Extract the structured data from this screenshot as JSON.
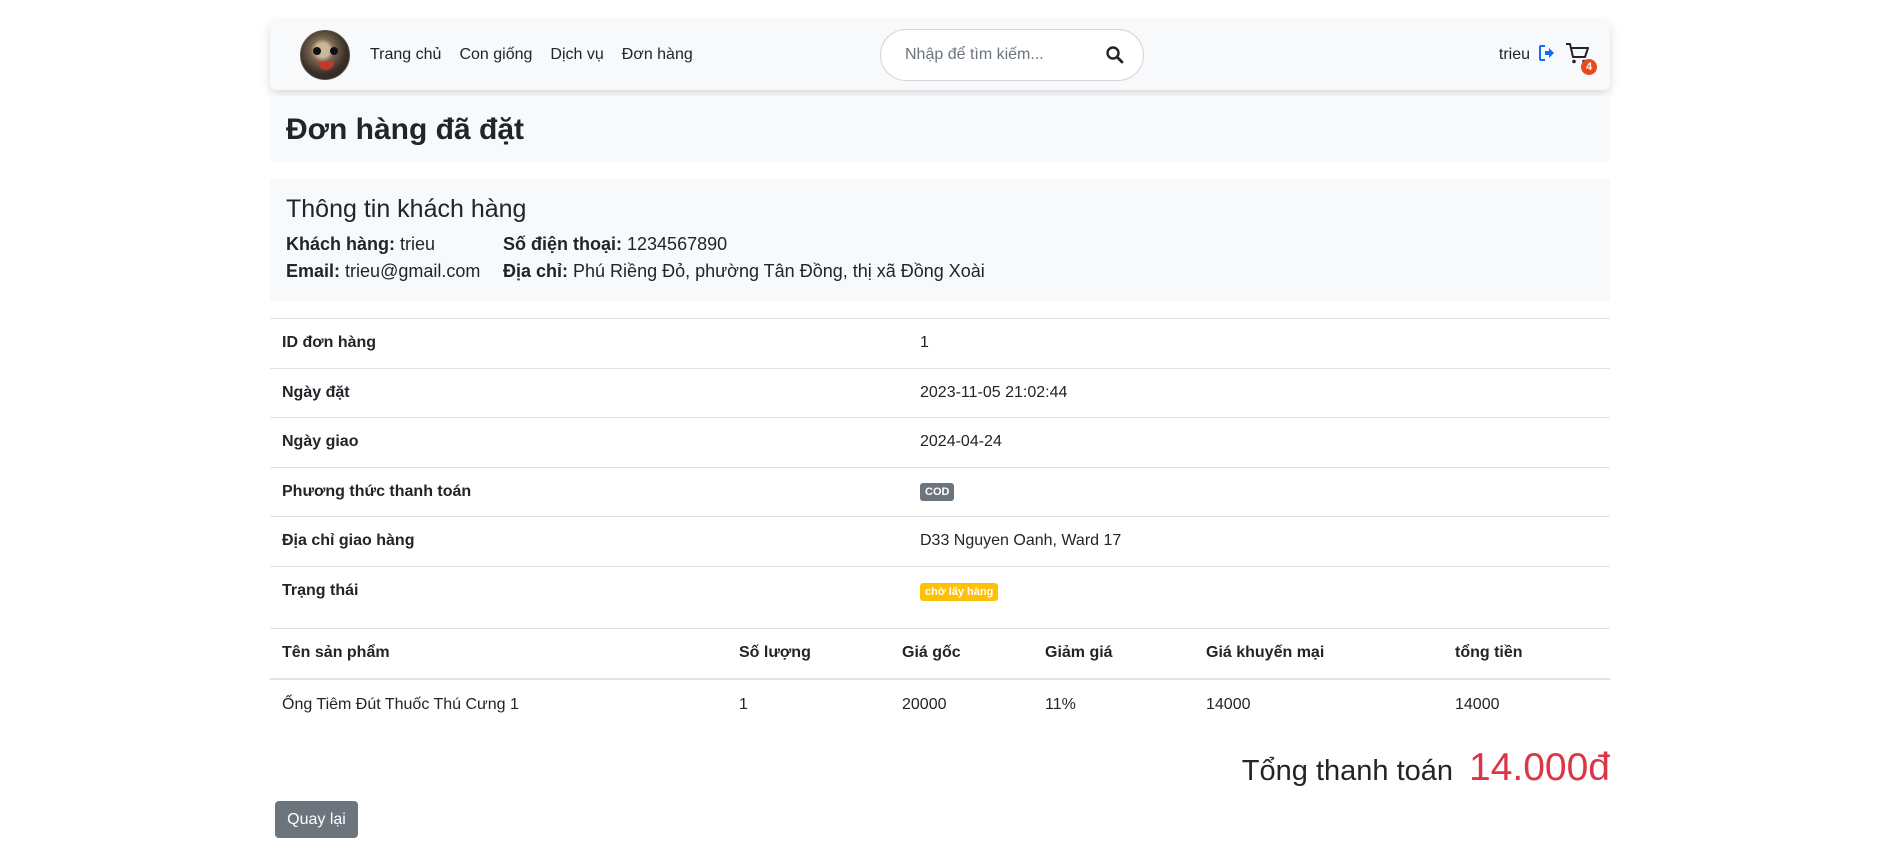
{
  "navbar": {
    "links": [
      "Trang chủ",
      "Con giống",
      "Dịch vụ",
      "Đơn hàng"
    ],
    "search_placeholder": "Nhập để tìm kiếm...",
    "username": "trieu",
    "cart_count": "4"
  },
  "page_title": "Đơn hàng đã đặt",
  "customer": {
    "heading": "Thông tin khách hàng",
    "name_label": "Khách hàng:",
    "name": "trieu",
    "phone_label": "Số điện thoại:",
    "phone": "1234567890",
    "email_label": "Email:",
    "email": "trieu@gmail.com",
    "address_label": "Địa chỉ:",
    "address": "Phú Riềng Đỏ, phường Tân Đồng, thị xã Đồng Xoài"
  },
  "order": {
    "rows": [
      {
        "label": "ID đơn hàng",
        "value": "1"
      },
      {
        "label": "Ngày đặt",
        "value": "2023-11-05 21:02:44"
      },
      {
        "label": "Ngày giao",
        "value": "2024-04-24"
      },
      {
        "label": "Phương thức thanh toán",
        "value": "COD"
      },
      {
        "label": "Địa chỉ giao hàng",
        "value": "D33 Nguyen Oanh, Ward 17"
      },
      {
        "label": "Trạng thái",
        "value": "chờ lấy hàng"
      }
    ]
  },
  "products": {
    "headers": [
      "Tên sản phẩm",
      "Số lượng",
      "Giá gốc",
      "Giảm giá",
      "Giá khuyến mại",
      "tổng tiền"
    ],
    "rows": [
      [
        "Ống Tiêm Đút Thuốc Thú Cưng 1",
        "1",
        "20000",
        "11%",
        "14000",
        "14000"
      ]
    ]
  },
  "total": {
    "label": "Tổng thanh toán",
    "value": "14.000đ"
  },
  "back_label": "Quay lại",
  "colors": {
    "accent_red": "#dc3545",
    "badge_gray": "#6c757d",
    "badge_yellow": "#ffc107",
    "cart_badge": "#e8491d",
    "logout_blue": "#0d6efd"
  }
}
